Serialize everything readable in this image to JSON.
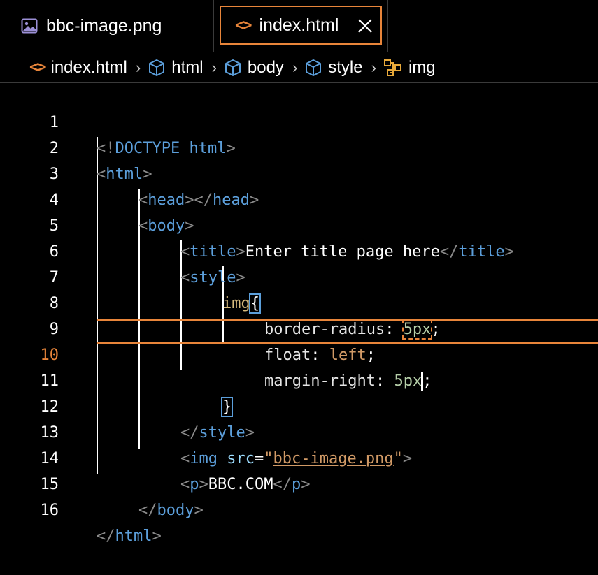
{
  "tabs": [
    {
      "label": "bbc-image.png",
      "icon": "image-icon",
      "active": false
    },
    {
      "label": "index.html",
      "icon": "code-icon",
      "active": true,
      "close": "×"
    }
  ],
  "breadcrumb": {
    "items": [
      {
        "label": "index.html",
        "icon": "code-icon"
      },
      {
        "label": "html",
        "icon": "symbol-box-icon"
      },
      {
        "label": "body",
        "icon": "symbol-box-icon"
      },
      {
        "label": "style",
        "icon": "symbol-box-icon"
      },
      {
        "label": "img",
        "icon": "symbol-structure-icon"
      }
    ],
    "separator": "›"
  },
  "editor": {
    "active_line": 10,
    "line_numbers": [
      "1",
      "2",
      "3",
      "4",
      "5",
      "6",
      "7",
      "8",
      "9",
      "10",
      "11",
      "12",
      "13",
      "14",
      "15",
      "16"
    ],
    "lines": {
      "l1": {
        "a": "<!",
        "b": "DOCTYPE",
        "c": " html",
        "d": ">"
      },
      "l2": {
        "a": "<",
        "b": "html",
        "c": ">"
      },
      "l3": {
        "a": "<",
        "b": "head",
        "c": "></",
        "d": "head",
        "e": ">"
      },
      "l4": {
        "a": "<",
        "b": "body",
        "c": ">"
      },
      "l5": {
        "a": "<",
        "b": "title",
        "c": ">",
        "d": "Enter title page here",
        "e": "</",
        "f": "title",
        "g": ">"
      },
      "l6": {
        "a": "<",
        "b": "style",
        "c": ">"
      },
      "l7": {
        "a": "img",
        "b": "{"
      },
      "l8": {
        "a": "border-radius",
        "b": ": ",
        "c": "5px",
        "d": ";"
      },
      "l9": {
        "a": "float",
        "b": ": ",
        "c": "left",
        "d": ";"
      },
      "l10": {
        "a": "margin-right",
        "b": ": ",
        "c": "5px",
        "d": ";"
      },
      "l11": {
        "a": "}"
      },
      "l12": {
        "a": "</",
        "b": "style",
        "c": ">"
      },
      "l13": {
        "a": "<",
        "b": "img",
        "c": " src",
        "d": "=",
        "e": "\"",
        "f": "bbc-image.png",
        "g": "\"",
        "h": ">"
      },
      "l14": {
        "a": "<",
        "b": "p",
        "c": ">",
        "d": "BBC.COM",
        "e": "</",
        "f": "p",
        "g": ">"
      },
      "l15": {
        "a": "</",
        "b": "body",
        "c": ">"
      },
      "l16": {
        "a": "</",
        "b": "html",
        "c": ">"
      }
    }
  },
  "colors": {
    "accent": "#e8853a",
    "tag": "#5c9fdb",
    "background": "#000000"
  }
}
